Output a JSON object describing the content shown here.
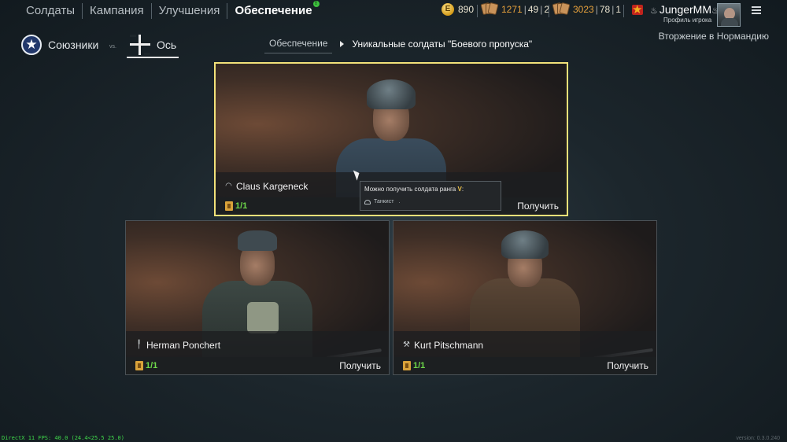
{
  "nav": {
    "items": [
      {
        "label": "Солдаты"
      },
      {
        "label": "Кампания"
      },
      {
        "label": "Улучшения"
      },
      {
        "label": "Обеспечение"
      }
    ],
    "badge": "!"
  },
  "resources": {
    "gold": "890",
    "gold_icon_label": "E",
    "silver_main": "1271",
    "silver_a": "49",
    "silver_b": "2",
    "gold_tickets_main": "3023",
    "gold_tickets_a": "78",
    "gold_tickets_b": "1",
    "sep": "|"
  },
  "user": {
    "name": "JungerMM",
    "name_prefix": "♨",
    "name_suffix": "♨",
    "profile_label": "Профиль игрока",
    "mode_title": "Вторжение в Нормандию"
  },
  "factions": {
    "allies": "Союзники",
    "vs": "vs.",
    "axis": "Ось"
  },
  "breadcrumb": {
    "root": "Обеспечение",
    "current": "Уникальные солдаты \"Боевого пропуска\""
  },
  "cards": [
    {
      "name": "Claus Kargeneck",
      "class_icon": "tank-icon",
      "count": "1/1",
      "action": "Получить"
    },
    {
      "name": "Herman Ponchert",
      "class_icon": "rifle-icon",
      "count": "1/1",
      "action": "Получить"
    },
    {
      "name": "Kurt Pitschmann",
      "class_icon": "wrench-icon",
      "count": "1/1",
      "action": "Получить"
    }
  ],
  "tooltip": {
    "text": "Можно получить солдата ранга",
    "rank": "V",
    "colon": ":",
    "class_name": "Танкист",
    "dot": "."
  },
  "footer": {
    "fps": "DirectX 11 FPS: 40.0 (24.4<25.5 25.0)",
    "version": "version: 0.3.0.240"
  },
  "colors": {
    "selected_border": "#f2e179",
    "count_green": "#6ed84a",
    "rank_gold": "#f1c64a"
  }
}
